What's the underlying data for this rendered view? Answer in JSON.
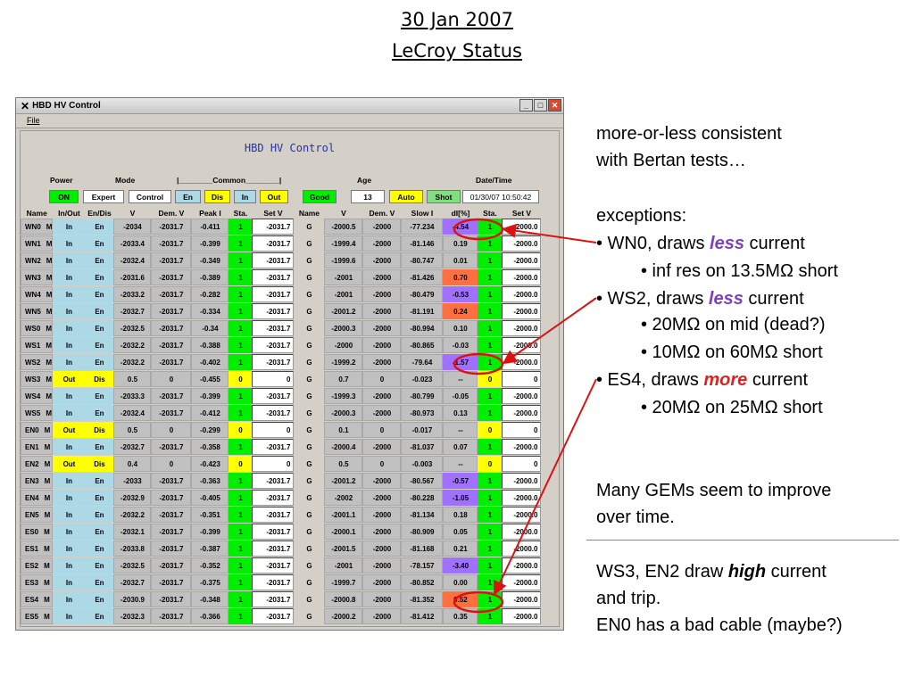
{
  "slide": {
    "date": "30 Jan 2007",
    "subtitle": "LeCroy Status"
  },
  "window": {
    "title": "HBD HV Control",
    "menu_file": "File",
    "panel_title": "HBD HV Control"
  },
  "controls": {
    "power_label": "Power",
    "mode_label": "Mode",
    "common_label": "|________Common________|",
    "age_label": "Age",
    "datetime_label": "Date/Time",
    "on": "ON",
    "expert": "Expert",
    "control": "Control",
    "en": "En",
    "dis": "Dis",
    "in": "In",
    "out": "Out",
    "good": "Good",
    "age_value": "13",
    "auto": "Auto",
    "shot": "Shot",
    "datetime": "01/30/07 10:50:42"
  },
  "columns": [
    "Name",
    "In/Out",
    "En/Dis",
    "V",
    "Dem. V",
    "Peak I",
    "Sta.",
    "Set V",
    "Name",
    "V",
    "Dem. V",
    "Slow I",
    "dI[%]",
    "Sta.",
    "Set V"
  ],
  "rows": [
    [
      "WN0",
      "M",
      "In",
      "En",
      "-2034",
      "-2031.7",
      "-0.411",
      "1",
      "-2031.7",
      "G",
      "-2000.5",
      "-2000",
      "-77.234",
      "-4.54",
      "1",
      "-2000.0"
    ],
    [
      "WN1",
      "M",
      "In",
      "En",
      "-2033.4",
      "-2031.7",
      "-0.399",
      "1",
      "-2031.7",
      "G",
      "-1999.4",
      "-2000",
      "-81.146",
      "0.19",
      "1",
      "-2000.0"
    ],
    [
      "WN2",
      "M",
      "In",
      "En",
      "-2032.4",
      "-2031.7",
      "-0.349",
      "1",
      "-2031.7",
      "G",
      "-1999.6",
      "-2000",
      "-80.747",
      "0.01",
      "1",
      "-2000.0"
    ],
    [
      "WN3",
      "M",
      "In",
      "En",
      "-2031.6",
      "-2031.7",
      "-0.389",
      "1",
      "-2031.7",
      "G",
      "-2001",
      "-2000",
      "-81.426",
      "0.70",
      "1",
      "-2000.0"
    ],
    [
      "WN4",
      "M",
      "In",
      "En",
      "-2033.2",
      "-2031.7",
      "-0.282",
      "1",
      "-2031.7",
      "G",
      "-2001",
      "-2000",
      "-80.479",
      "-0.53",
      "1",
      "-2000.0"
    ],
    [
      "WN5",
      "M",
      "In",
      "En",
      "-2032.7",
      "-2031.7",
      "-0.334",
      "1",
      "-2031.7",
      "G",
      "-2001.2",
      "-2000",
      "-81.191",
      "0.24",
      "1",
      "-2000.0"
    ],
    [
      "WS0",
      "M",
      "In",
      "En",
      "-2032.5",
      "-2031.7",
      "-0.34",
      "1",
      "-2031.7",
      "G",
      "-2000.3",
      "-2000",
      "-80.994",
      "0.10",
      "1",
      "-2000.0"
    ],
    [
      "WS1",
      "M",
      "In",
      "En",
      "-2032.2",
      "-2031.7",
      "-0.388",
      "1",
      "-2031.7",
      "G",
      "-2000",
      "-2000",
      "-80.865",
      "-0.03",
      "1",
      "-2000.0"
    ],
    [
      "WS2",
      "M",
      "In",
      "En",
      "-2032.2",
      "-2031.7",
      "-0.402",
      "1",
      "-2031.7",
      "G",
      "-1999.2",
      "-2000",
      "-79.64",
      "-1.57",
      "1",
      "-2000.0"
    ],
    [
      "WS3",
      "M",
      "Out",
      "Dis",
      "0.5",
      "0",
      "-0.455",
      "0",
      "0",
      "G",
      "0.7",
      "0",
      "-0.023",
      "--",
      "0",
      "0"
    ],
    [
      "WS4",
      "M",
      "In",
      "En",
      "-2033.3",
      "-2031.7",
      "-0.399",
      "1",
      "-2031.7",
      "G",
      "-1999.3",
      "-2000",
      "-80.799",
      "-0.05",
      "1",
      "-2000.0"
    ],
    [
      "WS5",
      "M",
      "In",
      "En",
      "-2032.4",
      "-2031.7",
      "-0.412",
      "1",
      "-2031.7",
      "G",
      "-2000.3",
      "-2000",
      "-80.973",
      "0.13",
      "1",
      "-2000.0"
    ],
    [
      "EN0",
      "M",
      "Out",
      "Dis",
      "0.5",
      "0",
      "-0.299",
      "0",
      "0",
      "G",
      "0.1",
      "0",
      "-0.017",
      "--",
      "0",
      "0"
    ],
    [
      "EN1",
      "M",
      "In",
      "En",
      "-2032.7",
      "-2031.7",
      "-0.358",
      "1",
      "-2031.7",
      "G",
      "-2000.4",
      "-2000",
      "-81.037",
      "0.07",
      "1",
      "-2000.0"
    ],
    [
      "EN2",
      "M",
      "Out",
      "Dis",
      "0.4",
      "0",
      "-0.423",
      "0",
      "0",
      "G",
      "0.5",
      "0",
      "-0.003",
      "--",
      "0",
      "0"
    ],
    [
      "EN3",
      "M",
      "In",
      "En",
      "-2033",
      "-2031.7",
      "-0.363",
      "1",
      "-2031.7",
      "G",
      "-2001.2",
      "-2000",
      "-80.567",
      "-0.57",
      "1",
      "-2000.0"
    ],
    [
      "EN4",
      "M",
      "In",
      "En",
      "-2032.9",
      "-2031.7",
      "-0.405",
      "1",
      "-2031.7",
      "G",
      "-2002",
      "-2000",
      "-80.228",
      "-1.05",
      "1",
      "-2000.0"
    ],
    [
      "EN5",
      "M",
      "In",
      "En",
      "-2032.2",
      "-2031.7",
      "-0.351",
      "1",
      "-2031.7",
      "G",
      "-2001.1",
      "-2000",
      "-81.134",
      "0.18",
      "1",
      "-2000.0"
    ],
    [
      "ES0",
      "M",
      "In",
      "En",
      "-2032.1",
      "-2031.7",
      "-0.399",
      "1",
      "-2031.7",
      "G",
      "-2000.1",
      "-2000",
      "-80.909",
      "0.05",
      "1",
      "-2000.0"
    ],
    [
      "ES1",
      "M",
      "In",
      "En",
      "-2033.8",
      "-2031.7",
      "-0.387",
      "1",
      "-2031.7",
      "G",
      "-2001.5",
      "-2000",
      "-81.168",
      "0.21",
      "1",
      "-2000.0"
    ],
    [
      "ES2",
      "M",
      "In",
      "En",
      "-2032.5",
      "-2031.7",
      "-0.352",
      "1",
      "-2031.7",
      "G",
      "-2001",
      "-2000",
      "-78.157",
      "-3.40",
      "1",
      "-2000.0"
    ],
    [
      "ES3",
      "M",
      "In",
      "En",
      "-2032.7",
      "-2031.7",
      "-0.375",
      "1",
      "-2031.7",
      "G",
      "-1999.7",
      "-2000",
      "-80.852",
      "0.00",
      "1",
      "-2000.0"
    ],
    [
      "ES4",
      "M",
      "In",
      "En",
      "-2030.9",
      "-2031.7",
      "-0.348",
      "1",
      "-2031.7",
      "G",
      "-2000.8",
      "-2000",
      "-81.352",
      "0.52",
      "1",
      "-2000.0"
    ],
    [
      "ES5",
      "M",
      "In",
      "En",
      "-2032.3",
      "-2031.7",
      "-0.366",
      "1",
      "-2031.7",
      "G",
      "-2000.2",
      "-2000",
      "-81.412",
      "0.35",
      "1",
      "-2000.0"
    ]
  ],
  "notes": {
    "l1": "more-or-less consistent",
    "l2": "with Bertan tests…",
    "l3": "exceptions:",
    "b1_pre": "• WN0, draws ",
    "b1_em": "less",
    "b1_post": " current",
    "b1_sub": "• inf res on 13.5MΩ short",
    "b2_pre": "• WS2, draws ",
    "b2_em": "less",
    "b2_post": " current",
    "b2_sub1": "• 20MΩ on mid (dead?)",
    "b2_sub2": "• 10MΩ on 60MΩ short",
    "b3_pre": "• ES4, draws ",
    "b3_em": "more",
    "b3_post": " current",
    "b3_sub": "• 20MΩ on 25MΩ short",
    "p1a": "Many GEMs seem to improve",
    "p1b": "over time.",
    "p2a_pre": "WS3, EN2 draw ",
    "p2a_em": "high",
    "p2a_post": " current",
    "p2b": "and trip.",
    "p2c": "EN0 has a bad cable (maybe?)"
  }
}
